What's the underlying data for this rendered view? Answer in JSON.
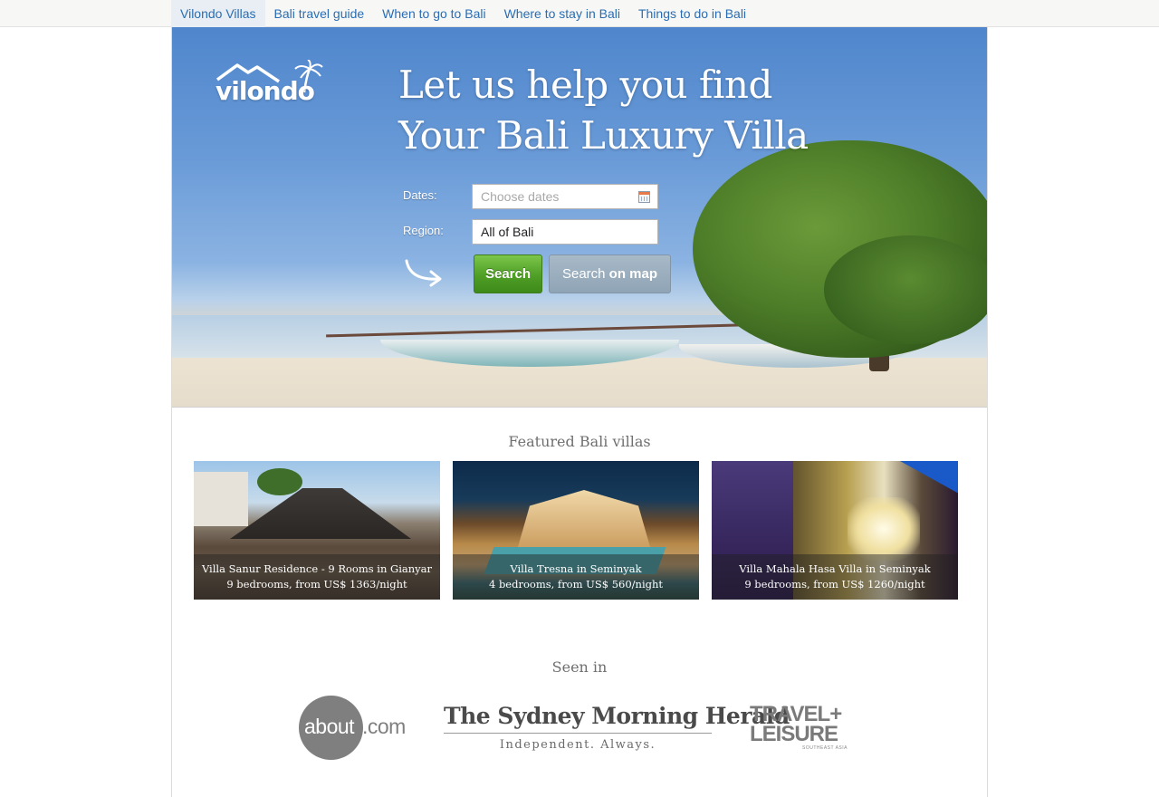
{
  "nav": {
    "items": [
      {
        "label": "Vilondo Villas"
      },
      {
        "label": "Bali travel guide"
      },
      {
        "label": "When to go to Bali"
      },
      {
        "label": "Where to stay in Bali"
      },
      {
        "label": "Things to do in Bali"
      }
    ],
    "active_index": 0
  },
  "hero": {
    "logo_text": "vilondo",
    "headline_line1": "Let us help you find",
    "headline_line2": "Your Bali Luxury Villa",
    "dates_label": "Dates:",
    "dates_placeholder": "Choose dates",
    "dates_icon": "calendar-icon",
    "region_label": "Region:",
    "region_value": "All of Bali",
    "search_button": "Search",
    "map_button_prefix": "Search",
    "map_button_bold": "on map",
    "arrow_icon": "curved-arrow-icon"
  },
  "featured": {
    "title": "Featured Bali villas",
    "villas": [
      {
        "name": "Villa Sanur Residence - 9 Rooms in Gianyar",
        "details": "9 bedrooms, from US$ 1363/night"
      },
      {
        "name": "Villa Tresna in Seminyak",
        "details": "4 bedrooms, from US$ 560/night"
      },
      {
        "name": "Villa Mahala Hasa Villa in Seminyak",
        "details": "9 bedrooms, from US$ 1260/night"
      }
    ]
  },
  "seen_in": {
    "title": "Seen in",
    "about": {
      "brand": "about",
      "suffix": ".com"
    },
    "smh": {
      "title": "The Sydney Morning Herald",
      "tagline": "Independent. Always."
    },
    "travel_leisure": {
      "line1": "TRAVEL+",
      "line2": "LEISURE",
      "sub": "SOUTHEAST ASIA"
    }
  },
  "colors": {
    "nav_link": "#2a6db3",
    "search_green": "#4f9e26",
    "map_button": "#8fa4b6",
    "heading_gray": "#6f6f6f"
  }
}
